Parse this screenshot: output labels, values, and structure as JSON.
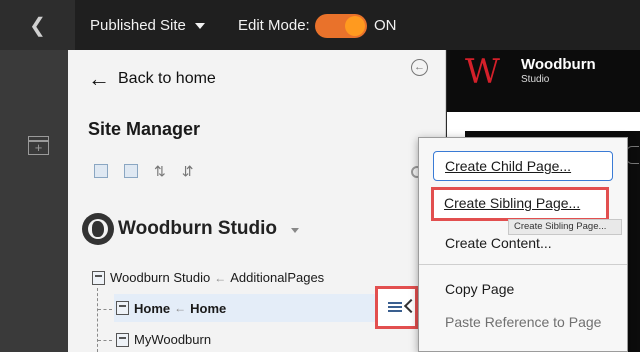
{
  "topbar": {
    "back_icon": "chevron-left-icon",
    "published_site": "Published Site",
    "edit_mode_label": "Edit Mode:",
    "edit_mode_state": "ON",
    "toggle_color": "#e9722b"
  },
  "panel": {
    "back_label": "Back to home",
    "title": "Site Manager",
    "site_name": "Woodburn Studio",
    "tree": {
      "root_site": "Woodburn Studio",
      "root_page": "AdditionalPages",
      "home_label": "Home",
      "home_target": "Home",
      "child2": "MyWoodburn"
    }
  },
  "preview": {
    "logo_letter": "W",
    "logo_title": "Woodburn",
    "logo_subtitle": "Studio",
    "brand_color": "#d4202a"
  },
  "context_menu": {
    "items": [
      {
        "label": "Create Child Page..."
      },
      {
        "label": "Create Sibling Page..."
      },
      {
        "label": "Create Content..."
      },
      {
        "label": "Copy Page"
      },
      {
        "label": "Paste Reference to Page"
      }
    ],
    "tooltip": "Create Sibling Page...",
    "highlight_color": "#e24f4f"
  }
}
